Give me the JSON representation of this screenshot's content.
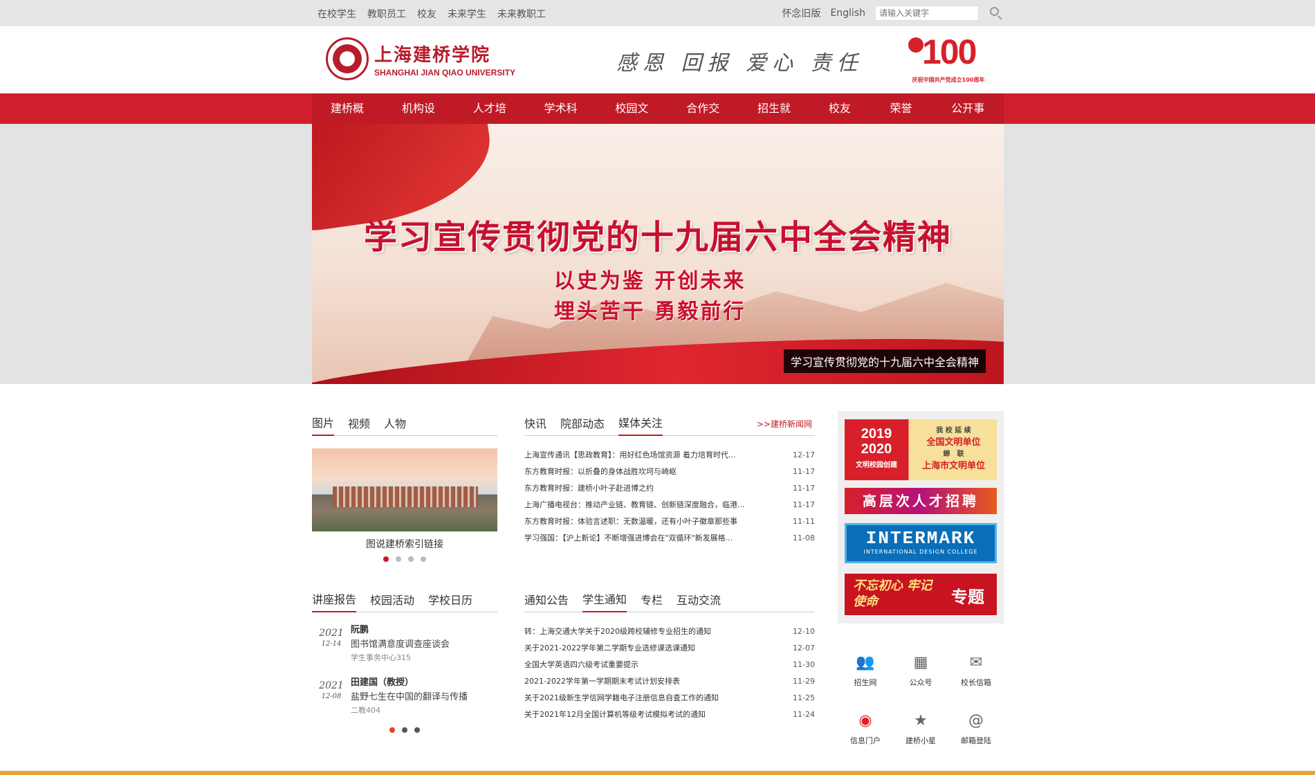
{
  "topbar": {
    "links": [
      "在校学生",
      "教职员工",
      "校友",
      "未来学生",
      "未来教职工"
    ],
    "old_version": "怀念旧版",
    "english": "English",
    "search_placeholder": "请输入关键字"
  },
  "header": {
    "logo_cn": "上海建桥学院",
    "logo_en": "SHANGHAI JIAN QIAO UNIVERSITY",
    "motto": "感恩 回报 爱心 责任",
    "centennial_num": "100",
    "centennial_caption": "庆祝中国共产党成立100周年"
  },
  "nav": [
    "建桥概览",
    "机构设置",
    "人才培养",
    "学术科研",
    "校园文化",
    "合作交流",
    "招生就业",
    "校友会",
    "荣誉榜",
    "公开事项"
  ],
  "banner": {
    "title": "学习宣传贯彻党的十九届六中全会精神",
    "line1": "以史为鉴   开创未来",
    "line2": "埋头苦干   勇毅前行",
    "caption": "学习宣传贯彻党的十九届六中全会精神"
  },
  "media": {
    "tabs": [
      "图片",
      "视频",
      "人物"
    ],
    "photo_caption": "图说建桥索引链接"
  },
  "news": {
    "tabs": [
      "快讯",
      "院部动态",
      "媒体关注"
    ],
    "more": ">>建桥新闻网",
    "items": [
      {
        "title": "上海宣传通讯【思政教育】：用好红色场馆资源 着力培育时代...",
        "date": "12-17"
      },
      {
        "title": "东方教育时报：以折叠的身体战胜坎坷与崎岖",
        "date": "11-17"
      },
      {
        "title": "东方教育时报：建桥小叶子赴进博之约",
        "date": "11-17"
      },
      {
        "title": "上海广播电视台：推动产业链、教育链、创新链深度融合，临港...",
        "date": "11-17"
      },
      {
        "title": "东方教育时报：体验言述职：无数温暖，还有小叶子徽章那些事",
        "date": "11-11"
      },
      {
        "title": "学习强国：【沪上新论】不断增强进博会在\"双循环\"新发展格...",
        "date": "11-08"
      }
    ]
  },
  "lectures": {
    "tabs": [
      "讲座报告",
      "校园活动",
      "学校日历"
    ],
    "items": [
      {
        "year": "2021",
        "md": "12-14",
        "name": "阮鹏",
        "title": "图书馆满意度调查座谈会",
        "place": "学生事务中心315"
      },
      {
        "year": "2021",
        "md": "12-08",
        "name": "田建国（教授）",
        "title": "盐野七生在中国的翻译与传播",
        "place": "二教404"
      }
    ]
  },
  "notices": {
    "tabs": [
      "通知公告",
      "学生通知",
      "专栏",
      "互动交流"
    ],
    "items": [
      {
        "title": "转：上海交通大学关于2020级跨校辅修专业招生的通知",
        "date": "12-10"
      },
      {
        "title": "关于2021-2022学年第二学期专业选修课选课通知",
        "date": "12-07"
      },
      {
        "title": "全国大学英语四六级考试重要提示",
        "date": "11-30"
      },
      {
        "title": "2021-2022学年第一学期期末考试计划安排表",
        "date": "11-29"
      },
      {
        "title": "关于2021级新生学信网学籍电子注册信息自查工作的通知",
        "date": "11-25"
      },
      {
        "title": "关于2021年12月全国计算机等级考试模拟考试的通知",
        "date": "11-24"
      }
    ]
  },
  "side": {
    "b1_year1": "2019",
    "b1_year2": "2020",
    "b1_left_caption": "文明校园创建",
    "b1_r1": "我 校 延 续",
    "b1_r2": "全国文明单位",
    "b1_r3": "蝉　联",
    "b1_r4": "上海市文明单位",
    "b2": "高层次人才招聘",
    "b3_title": "INTERMARK",
    "b3_sub": "INTERNATIONAL DESIGN COLLEGE",
    "b4_a": "不忘初心 牢记使命",
    "b4_b": "专题"
  },
  "quick": [
    {
      "label": "招生网",
      "icon": "users-icon"
    },
    {
      "label": "公众号",
      "icon": "grid-icon"
    },
    {
      "label": "校长信箱",
      "icon": "mail-icon"
    },
    {
      "label": "信息门户",
      "icon": "globe-icon"
    },
    {
      "label": "建桥小星",
      "icon": "star-search-icon"
    },
    {
      "label": "邮箱登陆",
      "icon": "at-mail-icon"
    }
  ]
}
